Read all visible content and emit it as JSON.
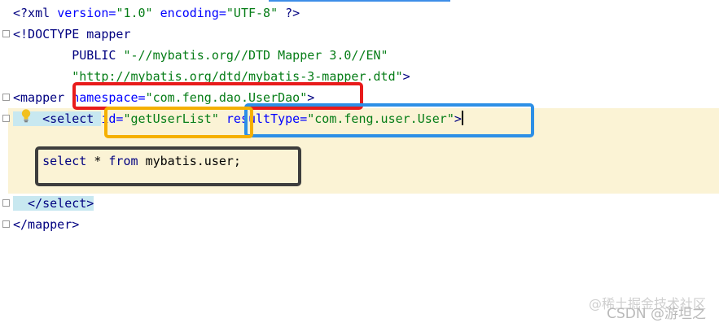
{
  "editor": {
    "lines": [
      {
        "id": "xml-decl",
        "parts": [
          {
            "c": "t-tag",
            "t": "<?xml "
          },
          {
            "c": "t-attr",
            "t": "version="
          },
          {
            "c": "t-str",
            "t": "\"1.0\" "
          },
          {
            "c": "t-attr",
            "t": "encoding="
          },
          {
            "c": "t-str",
            "t": "\"UTF-8\" "
          },
          {
            "c": "t-tag",
            "t": "?>"
          }
        ]
      },
      {
        "id": "doctype",
        "parts": [
          {
            "c": "t-tag",
            "t": "<!DOCTYPE mapper"
          }
        ]
      },
      {
        "id": "doctype-public",
        "parts": [
          {
            "c": "t-tag",
            "t": "        PUBLIC "
          },
          {
            "c": "t-str",
            "t": "\"-//mybatis.org//DTD Mapper 3.0//EN\""
          }
        ]
      },
      {
        "id": "doctype-url",
        "parts": [
          {
            "c": "t-str",
            "t": "        \"http://mybatis.org/dtd/mybatis-3-mapper.dtd\""
          },
          {
            "c": "t-tag",
            "t": ">"
          }
        ]
      },
      {
        "id": "mapper-open",
        "parts": [
          {
            "c": "t-tag",
            "t": "<mapper "
          },
          {
            "c": "t-attr",
            "t": "namespace="
          },
          {
            "c": "t-str",
            "t": "\"com.feng.dao.UserDao\""
          },
          {
            "c": "t-tag",
            "t": ">"
          }
        ]
      },
      {
        "id": "select-open",
        "parts": [
          {
            "c": "t-tag",
            "t": "    <select "
          },
          {
            "c": "t-attr",
            "t": "id="
          },
          {
            "c": "t-str",
            "t": "\"getUserList\" "
          },
          {
            "c": "t-attr",
            "t": "resultType="
          },
          {
            "c": "t-str",
            "t": "\"com.feng.user.User\""
          },
          {
            "c": "t-tag",
            "t": ">"
          }
        ]
      },
      {
        "id": "blank-1",
        "parts": []
      },
      {
        "id": "sql",
        "parts": [
          {
            "c": "t-kw",
            "t": "    select "
          },
          {
            "c": "t-plain",
            "t": "* "
          },
          {
            "c": "t-kw",
            "t": "from "
          },
          {
            "c": "t-plain",
            "t": "mybatis.user;"
          }
        ]
      },
      {
        "id": "blank-2",
        "parts": []
      },
      {
        "id": "select-close",
        "parts": [
          {
            "c": "t-tag",
            "t": "  </select>"
          }
        ]
      },
      {
        "id": "mapper-close",
        "parts": [
          {
            "c": "t-tag",
            "t": "</mapper>"
          }
        ]
      }
    ]
  },
  "watermark": {
    "line1": "@稀土掘金技术社区",
    "line2": "CSDN @游坦之"
  },
  "colors": {
    "red_box": "#e81b1b",
    "orange_box": "#f5b000",
    "blue_box": "#2d8fe6",
    "dark_box": "#3d3d3d",
    "highlight_band": "#fbf3d5"
  },
  "icons": {
    "intention": "lightbulb-icon",
    "fold": "fold-marker-icon"
  }
}
